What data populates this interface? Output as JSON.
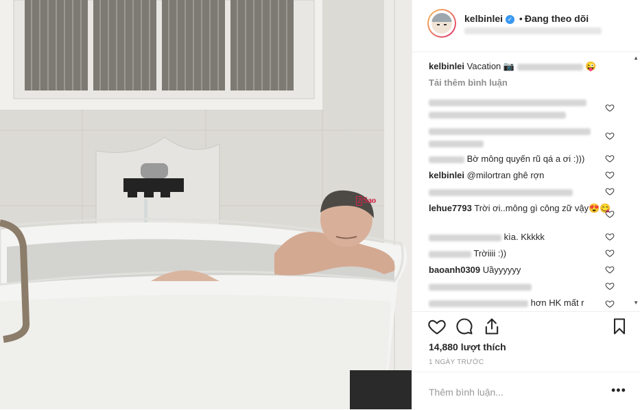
{
  "post": {
    "username": "kelbinlei",
    "verified_icon": "verified-badge-icon",
    "separator": "•",
    "follow_status": "Đang theo dõi"
  },
  "watermark": {
    "box": "2",
    "text": "Sao"
  },
  "caption": {
    "username": "kelbinlei",
    "text": "Vacation 📷",
    "emoji": "😜"
  },
  "load_more": "Tải thêm bình luận",
  "comments": [
    {
      "username": "",
      "text": ""
    },
    {
      "username": "",
      "text": ""
    },
    {
      "username": "",
      "text": "Bờ mông quyến rũ qá a ơi :)))"
    },
    {
      "username": "kelbinlei",
      "text": "@milortran ghê rợn"
    },
    {
      "username": "",
      "text": ""
    },
    {
      "username": "lehue7793",
      "text": "Trời ơi..mông gì công zữ vậy😍😋"
    },
    {
      "username": "",
      "text": "kìa. Kkkkk"
    },
    {
      "username": "",
      "text": "Trờiiii :))"
    },
    {
      "username": "baoanh0309",
      "text": "Uầyyyyyy"
    },
    {
      "username": "",
      "text": ""
    },
    {
      "username": "",
      "text": "hơn HK mất r"
    }
  ],
  "likes": "14,880 lượt thích",
  "time_ago": "1 NGÀY TRƯỚC",
  "add_comment_placeholder": "Thêm bình luận...",
  "more_label": "•••",
  "colors": {
    "accent": "#3897f0",
    "text": "#262626",
    "muted": "#8e8e8e",
    "border": "#efefef"
  }
}
